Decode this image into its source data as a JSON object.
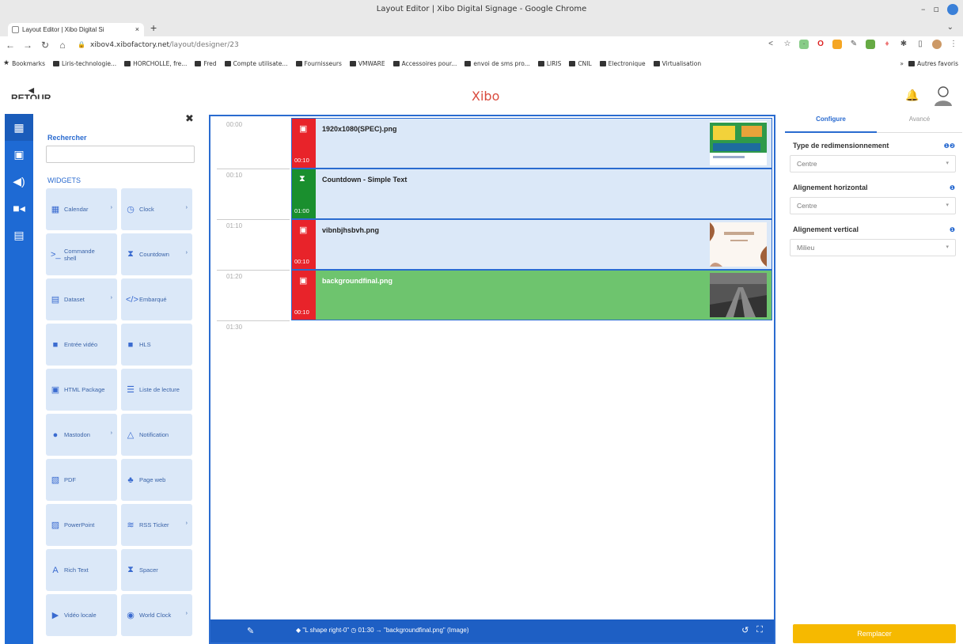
{
  "browser": {
    "window_title": "Layout Editor | Xibo Digital Signage - Google Chrome",
    "tab_title": "Layout Editor | Xibo Digital Si",
    "tab_close": "×",
    "new_tab": "+",
    "tab_menu": "⌄",
    "url_host": "xibov4.xibofactory.net",
    "url_path": "/layout/designer/23",
    "bookmarks": [
      "Bookmarks",
      "Liris-technologie...",
      "HORCHOLLE, fre...",
      "Fred",
      "Compte utilisate...",
      "Fournisseurs",
      "VMWARE",
      "Accessoires pour...",
      "envoi de sms pro...",
      "LIRIS",
      "CNIL",
      "Electronique",
      "Virtualisation"
    ],
    "bookmarks_more": "»",
    "bookmarks_other": "Autres favoris"
  },
  "app": {
    "back_label": "RETOUR",
    "logo": "Xibo"
  },
  "widgets_panel": {
    "search_label": "Rechercher",
    "section_title": "WIDGETS",
    "items": [
      {
        "label": "Calendar",
        "icon": "calendar-icon",
        "glyph": "▦",
        "arrow": true
      },
      {
        "label": "Clock",
        "icon": "clock-icon",
        "glyph": "◷",
        "arrow": true
      },
      {
        "label": "Commande shell",
        "icon": "terminal-icon",
        "glyph": ">_",
        "arrow": false
      },
      {
        "label": "Countdown",
        "icon": "hourglass-icon",
        "glyph": "⧗",
        "arrow": true
      },
      {
        "label": "Dataset",
        "icon": "table-icon",
        "glyph": "▤",
        "arrow": true
      },
      {
        "label": "Embarqué",
        "icon": "code-icon",
        "glyph": "</>",
        "arrow": false
      },
      {
        "label": "Entrée vidéo",
        "icon": "video-camera-icon",
        "glyph": "■",
        "arrow": false
      },
      {
        "label": "HLS",
        "icon": "video-camera-icon",
        "glyph": "■",
        "arrow": false
      },
      {
        "label": "HTML Package",
        "icon": "file-code-icon",
        "glyph": "▣",
        "arrow": false
      },
      {
        "label": "Liste de lecture",
        "icon": "playlist-icon",
        "glyph": "☰",
        "arrow": false
      },
      {
        "label": "Mastodon",
        "icon": "mastodon-icon",
        "glyph": "●",
        "arrow": true
      },
      {
        "label": "Notification",
        "icon": "bell-icon",
        "glyph": "△",
        "arrow": false
      },
      {
        "label": "PDF",
        "icon": "pdf-icon",
        "glyph": "▧",
        "arrow": false
      },
      {
        "label": "Page web",
        "icon": "sitemap-icon",
        "glyph": "♣",
        "arrow": false
      },
      {
        "label": "PowerPoint",
        "icon": "powerpoint-icon",
        "glyph": "▨",
        "arrow": false
      },
      {
        "label": "RSS Ticker",
        "icon": "rss-icon",
        "glyph": "≋",
        "arrow": true
      },
      {
        "label": "Rich Text",
        "icon": "text-icon",
        "glyph": "A",
        "arrow": false
      },
      {
        "label": "Spacer",
        "icon": "hourglass-icon",
        "glyph": "⧗",
        "arrow": false
      },
      {
        "label": "Vidéo locale",
        "icon": "file-video-icon",
        "glyph": "▶",
        "arrow": false
      },
      {
        "label": "World Clock",
        "icon": "globe-icon",
        "glyph": "◉",
        "arrow": true
      }
    ]
  },
  "timeline": {
    "ticks": [
      "00:00",
      "00:10",
      "01:10",
      "01:20",
      "01:30"
    ],
    "rows": [
      {
        "name": "1920x1080(SPEC).png",
        "duration": "00:10",
        "badge_color": "#e8232a",
        "type": "image"
      },
      {
        "name": "Countdown - Simple Text",
        "duration": "01:00",
        "badge_color": "#1a8f2e",
        "type": "countdown"
      },
      {
        "name": "vibnbjhsbvh.png",
        "duration": "00:10",
        "badge_color": "#e8232a",
        "type": "image"
      },
      {
        "name": "backgroundfinal.png",
        "duration": "00:10",
        "badge_color": "#e8232a",
        "type": "image"
      }
    ],
    "footer_text": "\"L shape right-0\"  ◷ 01:30  →  \"backgroundfinal.png\" (Image)"
  },
  "properties": {
    "tab_configure": "Configure",
    "tab_advanced": "Avancé",
    "fields": [
      {
        "label": "Type de redimensionnement",
        "value": "Centre"
      },
      {
        "label": "Alignement horizontal",
        "value": "Centre"
      },
      {
        "label": "Alignement vertical",
        "value": "Milieu"
      }
    ],
    "replace_button": "Remplacer"
  },
  "colors": {
    "accent": "#2a6bd0",
    "nav": "#1e6ad4",
    "image_badge": "#e8232a",
    "countdown_badge": "#1a8f2e",
    "replace": "#f6b900"
  }
}
